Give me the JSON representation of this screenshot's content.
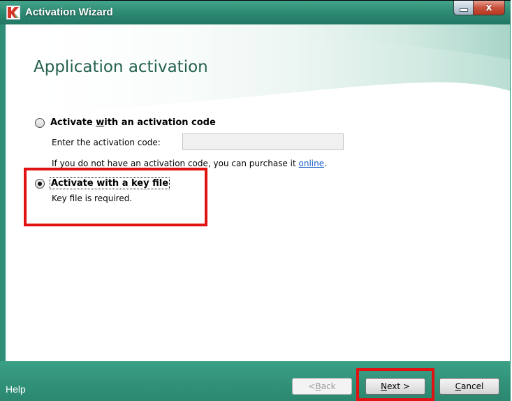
{
  "window": {
    "title": "Activation Wizard",
    "brand_color": "#2f8e78",
    "close_glyph": "x"
  },
  "page": {
    "heading": "Application activation"
  },
  "options": {
    "activation_code": {
      "label_pre": "Activate ",
      "label_accel": "w",
      "label_post": "ith an activation code",
      "selected": false,
      "field_label": "Enter the activation code:",
      "field_value": "",
      "purchase_text": "If you do not have an activation code, you can purchase it ",
      "purchase_link": "online",
      "purchase_end": "."
    },
    "key_file": {
      "label": "Activate with a key file",
      "selected": true,
      "note": "Key file is required."
    }
  },
  "footer": {
    "help_label": "Help",
    "back_label_pre": "< ",
    "back_label_accel": "B",
    "back_label_post": "ack",
    "back_enabled": false,
    "next_label_accel": "N",
    "next_label_post": "ext >",
    "cancel_label_accel": "C",
    "cancel_label_post": "ancel"
  },
  "annotations": {
    "highlight_color": "#e11212"
  }
}
